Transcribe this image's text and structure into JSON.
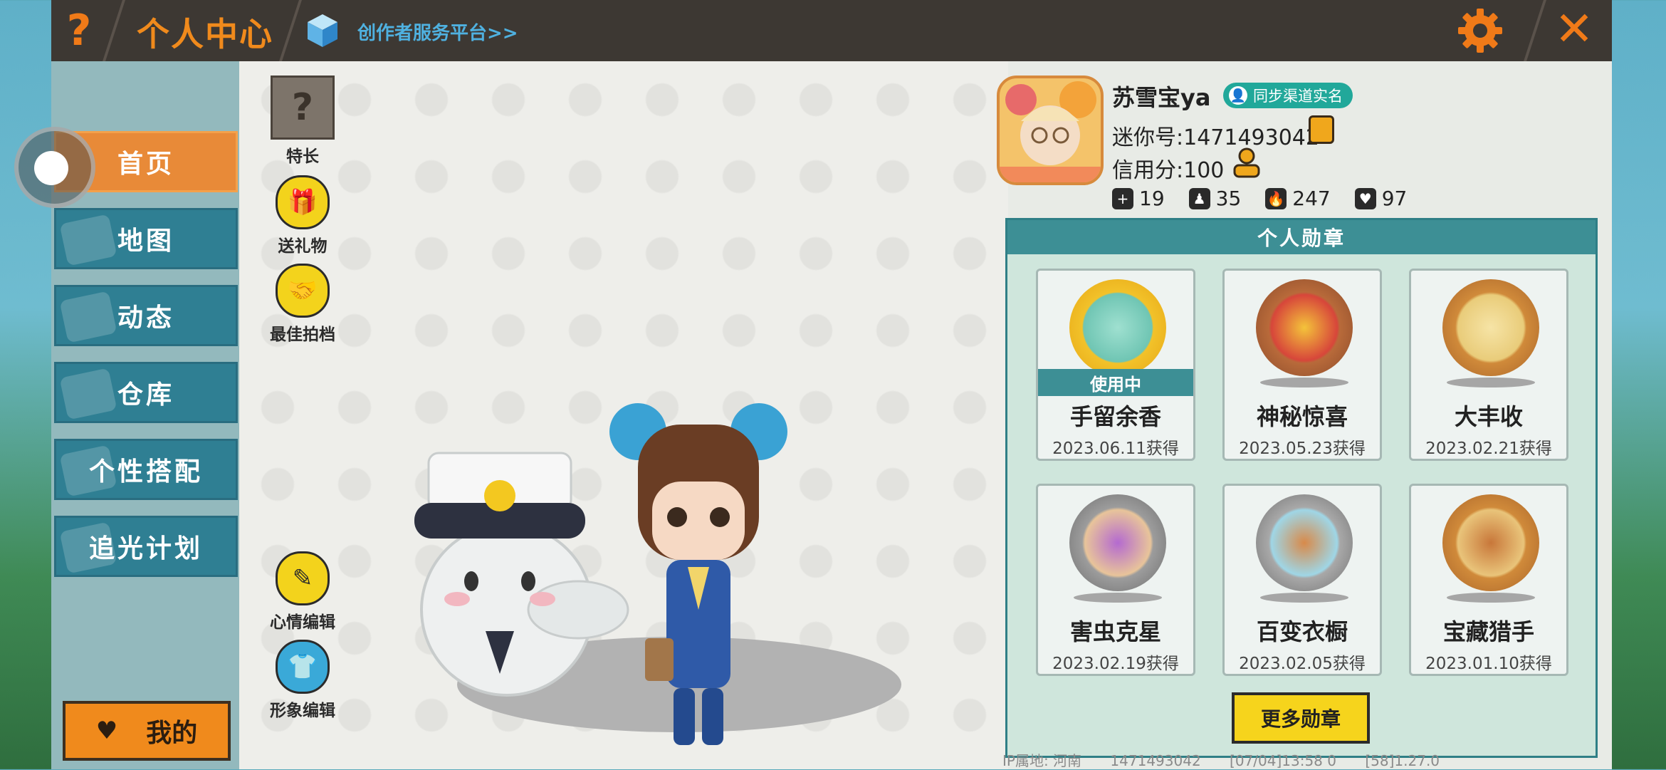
{
  "header": {
    "help_icon": "question-mark-icon",
    "title": "个人中心",
    "creator_link": "创作者服务平台>>",
    "settings_icon": "gear-icon",
    "close_icon": "close-x-icon",
    "accent_color": "#f07a18"
  },
  "sidebar": {
    "items": [
      {
        "label": "首页",
        "active": true
      },
      {
        "label": "地图",
        "active": false
      },
      {
        "label": "动态",
        "active": false
      },
      {
        "label": "仓库",
        "active": false
      },
      {
        "label": "个性搭配",
        "active": false
      },
      {
        "label": "追光计划",
        "active": false
      }
    ],
    "mine_button": "我的"
  },
  "actions": {
    "specialty": "特长",
    "send_gift": "送礼物",
    "best_photo": "最佳拍档",
    "mood_edit": "心情编辑",
    "avatar_edit": "形象编辑"
  },
  "profile": {
    "username": "苏雪宝ya",
    "sync_label": "同步渠道实名",
    "mini_id": "迷你号:1471493042",
    "credit": "信用分:100",
    "stats": {
      "likes": "19",
      "fans": "35",
      "popularity": "247",
      "hearts": "97"
    }
  },
  "medals": {
    "title": "个人勋章",
    "in_use_label": "使用中",
    "items": [
      {
        "name": "手留余香",
        "date": "2023.06.11获得"
      },
      {
        "name": "神秘惊喜",
        "date": "2023.05.23获得"
      },
      {
        "name": "大丰收",
        "date": "2023.02.21获得"
      },
      {
        "name": "害虫克星",
        "date": "2023.02.19获得"
      },
      {
        "name": "百变衣橱",
        "date": "2023.02.05获得"
      },
      {
        "name": "宝藏猎手",
        "date": "2023.01.10获得"
      }
    ],
    "more_button": "更多勋章"
  },
  "footer": {
    "ip": "IP属地: 河南",
    "id": "1471493042",
    "time": "[07/04]13:58 0",
    "version": "[58]1.27.0"
  }
}
